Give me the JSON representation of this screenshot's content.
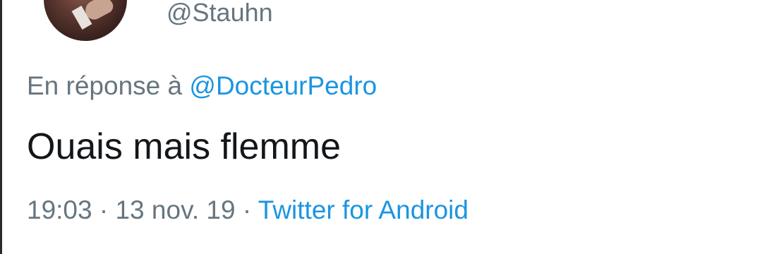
{
  "tweet": {
    "handle": "@Stauhn",
    "reply_prefix": "En réponse à",
    "reply_to": "@DocteurPedro",
    "text": "Ouais mais flemme",
    "time": "19:03",
    "separator_1": "·",
    "date": "13 nov. 19",
    "separator_2": "·",
    "source": "Twitter for Android"
  },
  "colors": {
    "link": "#1b95e0",
    "secondary_text": "#66757f",
    "primary_text": "#14171a"
  }
}
